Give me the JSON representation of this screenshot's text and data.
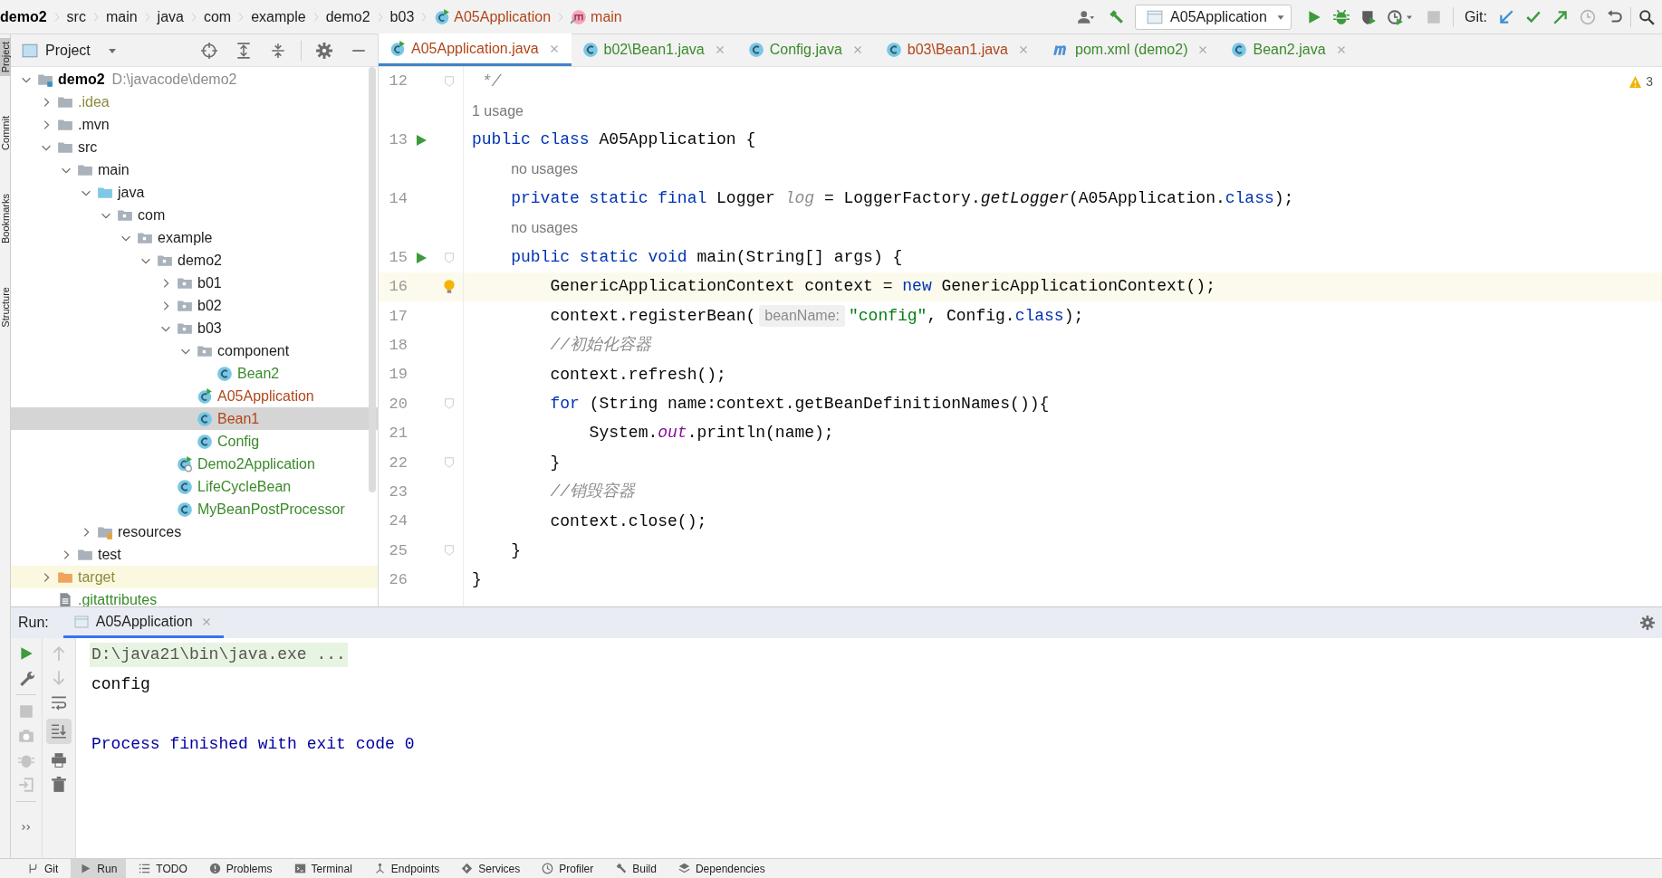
{
  "breadcrumbs": [
    {
      "label": "demo2",
      "kind": "project"
    },
    {
      "label": "src",
      "kind": "folder"
    },
    {
      "label": "main",
      "kind": "folder"
    },
    {
      "label": "java",
      "kind": "folder"
    },
    {
      "label": "com",
      "kind": "folder"
    },
    {
      "label": "example",
      "kind": "folder"
    },
    {
      "label": "demo2",
      "kind": "folder"
    },
    {
      "label": "b03",
      "kind": "folder"
    },
    {
      "label": "A05Application",
      "kind": "runnable_class"
    },
    {
      "label": "main",
      "kind": "method"
    }
  ],
  "toolbar": {
    "run_configuration": "A05Application",
    "git_label": "Git:"
  },
  "side_stripe": [
    {
      "label": "Project",
      "selected": true
    },
    {
      "label": "Commit",
      "selected": false
    },
    {
      "label": "Bookmarks",
      "selected": false
    },
    {
      "label": "Structure",
      "selected": false
    }
  ],
  "project_panel": {
    "title": "Project",
    "tree": [
      {
        "label": "demo2",
        "path": "D:\\javacode\\demo2",
        "kind": "module",
        "expanded": true,
        "selected": false,
        "children": [
          {
            "label": ".idea",
            "kind": "folder",
            "color": "#8c8a3c",
            "expanded": false,
            "selected": false
          },
          {
            "label": ".mvn",
            "kind": "folder",
            "expanded": false,
            "selected": false
          },
          {
            "label": "src",
            "kind": "folder",
            "expanded": true,
            "selected": false,
            "children": [
              {
                "label": "main",
                "kind": "folder",
                "expanded": true,
                "selected": false,
                "children": [
                  {
                    "label": "java",
                    "kind": "source_root",
                    "expanded": true,
                    "selected": false,
                    "children": [
                      {
                        "label": "com",
                        "kind": "package",
                        "expanded": true,
                        "selected": false,
                        "children": [
                          {
                            "label": "example",
                            "kind": "package",
                            "expanded": true,
                            "selected": false,
                            "children": [
                              {
                                "label": "demo2",
                                "kind": "package",
                                "expanded": true,
                                "selected": false,
                                "children": [
                                  {
                                    "label": "b01",
                                    "kind": "package",
                                    "expanded": false,
                                    "selected": false
                                  },
                                  {
                                    "label": "b02",
                                    "kind": "package",
                                    "expanded": false,
                                    "selected": false
                                  },
                                  {
                                    "label": "b03",
                                    "kind": "package",
                                    "expanded": true,
                                    "selected": false,
                                    "children": [
                                      {
                                        "label": "component",
                                        "kind": "package",
                                        "expanded": true,
                                        "selected": false,
                                        "children": [
                                          {
                                            "label": "Bean2",
                                            "kind": "class",
                                            "color": "#3b8a2b",
                                            "selected": false
                                          }
                                        ]
                                      },
                                      {
                                        "label": "A05Application",
                                        "kind": "runnable_class",
                                        "color": "#b0461b",
                                        "selected": false
                                      },
                                      {
                                        "label": "Bean1",
                                        "kind": "class",
                                        "color": "#b0461b",
                                        "selected": true
                                      },
                                      {
                                        "label": "Config",
                                        "kind": "class",
                                        "color": "#3b8a2b",
                                        "selected": false
                                      }
                                    ]
                                  },
                                  {
                                    "label": "Demo2Application",
                                    "kind": "boot_class",
                                    "color": "#3b8a2b",
                                    "selected": false
                                  },
                                  {
                                    "label": "LifeCycleBean",
                                    "kind": "class",
                                    "color": "#3b8a2b",
                                    "selected": false
                                  },
                                  {
                                    "label": "MyBeanPostProcessor",
                                    "kind": "class",
                                    "color": "#3b8a2b",
                                    "selected": false
                                  }
                                ]
                              }
                            ]
                          }
                        ]
                      }
                    ]
                  },
                  {
                    "label": "resources",
                    "kind": "resources_root",
                    "expanded": false,
                    "selected": false
                  }
                ]
              },
              {
                "label": "test",
                "kind": "folder",
                "expanded": false,
                "selected": false
              }
            ]
          },
          {
            "label": "target",
            "kind": "excluded_folder",
            "color": "#8c8a3c",
            "expanded": false,
            "selected": false
          },
          {
            "label": ".gitattributes",
            "kind": "file",
            "color": "#3b8a2b",
            "selected": false
          }
        ]
      }
    ]
  },
  "editor_tabs": [
    {
      "label": "A05Application.java",
      "kind": "runnable_class",
      "color": "#b0461b",
      "selected": true
    },
    {
      "label": "b02\\Bean1.java",
      "kind": "class",
      "color": "#3b8a2b",
      "selected": false
    },
    {
      "label": "Config.java",
      "kind": "class",
      "color": "#3b8a2b",
      "selected": false
    },
    {
      "label": "b03\\Bean1.java",
      "kind": "class",
      "color": "#b0461b",
      "selected": false
    },
    {
      "label": "pom.xml (demo2)",
      "kind": "maven",
      "color": "#3b8a2b",
      "selected": false
    },
    {
      "label": "Bean2.java",
      "kind": "class",
      "color": "#3b8a2b",
      "selected": false
    }
  ],
  "editor": {
    "warning_count": "3",
    "lines": [
      {
        "number": "12",
        "fold_marker": true,
        "tokens": [
          {
            "t": " */",
            "kind": "comment"
          }
        ]
      },
      {
        "number": "13",
        "usage_hint": "1 usage",
        "run_marker": true,
        "tokens": [
          {
            "t": "public class ",
            "kind": "keyword"
          },
          {
            "t": "A05Application {",
            "kind": "plain"
          }
        ]
      },
      {
        "number": "14",
        "usage_hint": "no usages",
        "tokens": [
          {
            "t": "    private static final ",
            "kind": "keyword"
          },
          {
            "t": "Logger ",
            "kind": "plain"
          },
          {
            "t": "log",
            "kind": "unused"
          },
          {
            "t": " = LoggerFactory.",
            "kind": "plain"
          },
          {
            "t": "getLogger",
            "kind": "static_call"
          },
          {
            "t": "(A05Application.",
            "kind": "plain"
          },
          {
            "t": "class",
            "kind": "keyword"
          },
          {
            "t": ");",
            "kind": "plain"
          }
        ]
      },
      {
        "number": "15",
        "usage_hint": "no usages",
        "run_marker": true,
        "fold_marker": true,
        "tokens": [
          {
            "t": "    public static void ",
            "kind": "keyword"
          },
          {
            "t": "main(String[] args) {",
            "kind": "plain"
          }
        ]
      },
      {
        "number": "16",
        "intention_bulb": true,
        "current": true,
        "tokens": [
          {
            "t": "        GenericApplicationContext context = ",
            "kind": "plain"
          },
          {
            "t": "new ",
            "kind": "keyword"
          },
          {
            "t": "GenericApplicationContext();",
            "kind": "plain"
          }
        ]
      },
      {
        "number": "17",
        "tokens": [
          {
            "t": "        context.registerBean(",
            "kind": "plain"
          },
          {
            "t": "beanName:",
            "kind": "inlay"
          },
          {
            "t": "\"config\"",
            "kind": "string"
          },
          {
            "t": ", Config.",
            "kind": "plain"
          },
          {
            "t": "class",
            "kind": "keyword"
          },
          {
            "t": ");",
            "kind": "plain"
          }
        ]
      },
      {
        "number": "18",
        "tokens": [
          {
            "t": "        //初始化容器",
            "kind": "comment"
          }
        ]
      },
      {
        "number": "19",
        "tokens": [
          {
            "t": "        context.refresh();",
            "kind": "plain"
          }
        ]
      },
      {
        "number": "20",
        "fold_marker": true,
        "tokens": [
          {
            "t": "        for ",
            "kind": "keyword"
          },
          {
            "t": "(String name:context.getBeanDefinitionNames()){",
            "kind": "plain"
          }
        ]
      },
      {
        "number": "21",
        "tokens": [
          {
            "t": "            System.",
            "kind": "plain"
          },
          {
            "t": "out",
            "kind": "static_field"
          },
          {
            "t": ".println(name);",
            "kind": "plain"
          }
        ]
      },
      {
        "number": "22",
        "fold_marker": true,
        "tokens": [
          {
            "t": "        }",
            "kind": "plain"
          }
        ]
      },
      {
        "number": "23",
        "tokens": [
          {
            "t": "        //销毁容器",
            "kind": "comment"
          }
        ]
      },
      {
        "number": "24",
        "tokens": [
          {
            "t": "        context.close();",
            "kind": "plain"
          }
        ]
      },
      {
        "number": "25",
        "fold_marker": true,
        "tokens": [
          {
            "t": "    }",
            "kind": "plain"
          }
        ]
      },
      {
        "number": "26",
        "tokens": [
          {
            "t": "}",
            "kind": "plain"
          }
        ]
      }
    ]
  },
  "run_panel": {
    "title": "Run:",
    "tabs": [
      {
        "label": "A05Application",
        "selected": true
      }
    ],
    "console": [
      {
        "text": "D:\\java21\\bin\\java.exe ...",
        "kind": "command"
      },
      {
        "text": "config",
        "kind": "output"
      },
      {
        "text": "Process finished with exit code 0",
        "kind": "system",
        "gap_before": true
      }
    ]
  },
  "bottom_tabs": [
    {
      "label": "Git",
      "kind": "git",
      "selected": false
    },
    {
      "label": "Run",
      "kind": "run",
      "selected": true
    },
    {
      "label": "TODO",
      "kind": "list",
      "selected": false
    },
    {
      "label": "Problems",
      "kind": "problems",
      "selected": false
    },
    {
      "label": "Terminal",
      "kind": "terminal",
      "selected": false
    },
    {
      "label": "Endpoints",
      "kind": "endpoints",
      "selected": false
    },
    {
      "label": "Services",
      "kind": "services",
      "selected": false
    },
    {
      "label": "Profiler",
      "kind": "profiler",
      "selected": false
    },
    {
      "label": "Build",
      "kind": "build",
      "selected": false
    },
    {
      "label": "Dependencies",
      "kind": "dependencies",
      "selected": false
    }
  ]
}
